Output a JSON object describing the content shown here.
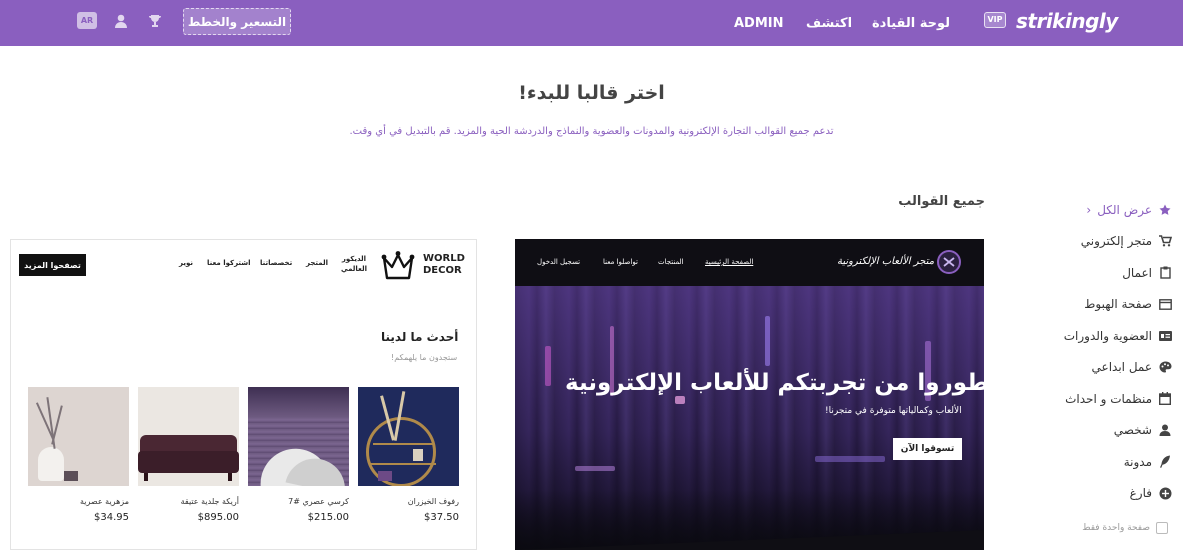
{
  "topbar": {
    "logo": "strikingly",
    "vip_badge": "VIP",
    "nav": [
      "لوحة القيادة",
      "اكتشف",
      "ADMIN"
    ],
    "pricing_button": "التسعير والخطط",
    "lang_badge": "AR",
    "icons": [
      "trophy-icon",
      "user-icon"
    ],
    "color": "#8a5fbf"
  },
  "page": {
    "heading": "اختر قالبا للبدء!",
    "subheading": "تدعم جميع القوالب التجارة الإلكترونية والمدونات والعضوية والنماذج والدردشة الحية والمزيد. قم بالتبديل في أي وقت.",
    "section_title": "جميع القوالب"
  },
  "sidebar": {
    "items": [
      {
        "label": "عرض الكل",
        "icon": "star-icon",
        "active": true
      },
      {
        "label": "متجر إلكتروني",
        "icon": "cart-icon"
      },
      {
        "label": "اعمال",
        "icon": "clipboard-icon"
      },
      {
        "label": "صفحة الهبوط",
        "icon": "browser-window-icon"
      },
      {
        "label": "العضوية والدورات",
        "icon": "id-card-icon"
      },
      {
        "label": "عمل ابداعي",
        "icon": "palette-icon"
      },
      {
        "label": "منظمات و احداث",
        "icon": "calendar-icon"
      },
      {
        "label": "شخصي",
        "icon": "person-icon"
      },
      {
        "label": "مدونة",
        "icon": "feather-icon"
      },
      {
        "label": "فارغ",
        "icon": "plus-circle-icon"
      }
    ],
    "single_page_label": "صفحة واحدة فقط",
    "single_page_checked": false
  },
  "template_gaming": {
    "store_name": "متجر الألعاب الإلكترونية",
    "nav": [
      "الصفحة الرئيسية",
      "المنتجات",
      "تواصلوا معنا",
      "تسجيل الدخول"
    ],
    "hero_title": "طوروا من تجربتكم للألعاب الإلكترونية",
    "hero_subtitle": "الألعاب وكمالياتها متوفرة في متجرنا!",
    "cta": "تسوقوا الآن"
  },
  "template_decor": {
    "brand_line1": "WORLD",
    "brand_line2": "DECOR",
    "nav": [
      "الديكور العالمي",
      "المتجر",
      "تخصصاتنا",
      "اشتركوا معنا",
      "نوير"
    ],
    "cta": "تصفحوا المزيد",
    "section_title": "أحدث ما لدينا",
    "section_subtitle": "ستجدون ما يلهمكم!",
    "products": [
      {
        "name": "رفوف الخيزران",
        "price": "$37.50"
      },
      {
        "name": "كرسي عصري #7",
        "price": "$215.00"
      },
      {
        "name": "أريكة جلدية عتيقة",
        "price": "$895.00"
      },
      {
        "name": "مزهرية عصرية",
        "price": "$34.95"
      }
    ]
  }
}
